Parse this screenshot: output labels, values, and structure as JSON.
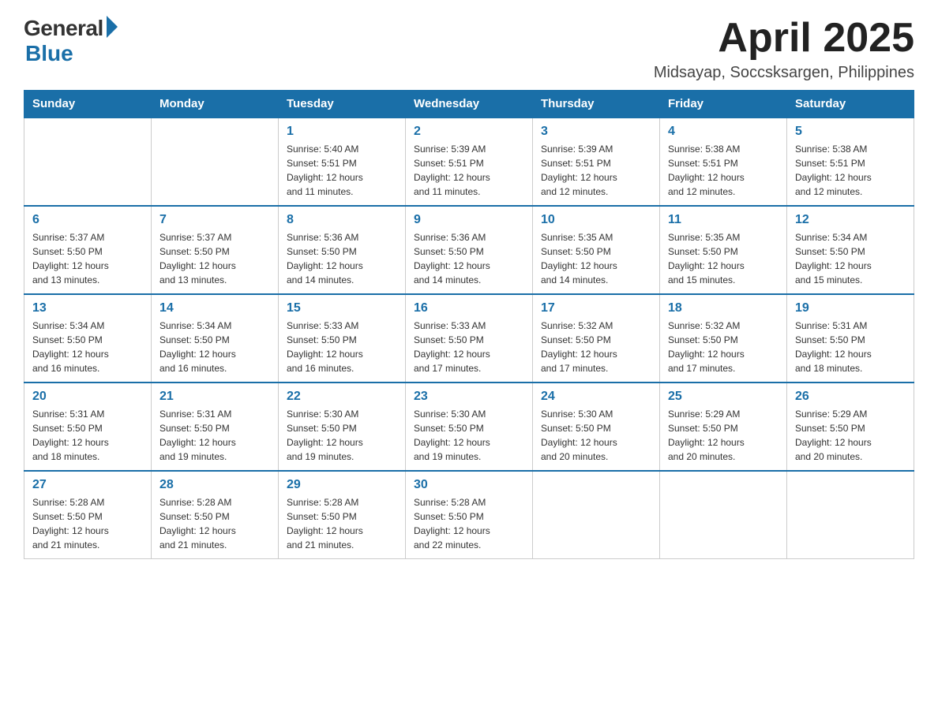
{
  "logo": {
    "general": "General",
    "blue": "Blue"
  },
  "title": {
    "month_year": "April 2025",
    "location": "Midsayap, Soccsksargen, Philippines"
  },
  "days_of_week": [
    "Sunday",
    "Monday",
    "Tuesday",
    "Wednesday",
    "Thursday",
    "Friday",
    "Saturday"
  ],
  "weeks": [
    [
      {
        "day": "",
        "info": ""
      },
      {
        "day": "",
        "info": ""
      },
      {
        "day": "1",
        "info": "Sunrise: 5:40 AM\nSunset: 5:51 PM\nDaylight: 12 hours\nand 11 minutes."
      },
      {
        "day": "2",
        "info": "Sunrise: 5:39 AM\nSunset: 5:51 PM\nDaylight: 12 hours\nand 11 minutes."
      },
      {
        "day": "3",
        "info": "Sunrise: 5:39 AM\nSunset: 5:51 PM\nDaylight: 12 hours\nand 12 minutes."
      },
      {
        "day": "4",
        "info": "Sunrise: 5:38 AM\nSunset: 5:51 PM\nDaylight: 12 hours\nand 12 minutes."
      },
      {
        "day": "5",
        "info": "Sunrise: 5:38 AM\nSunset: 5:51 PM\nDaylight: 12 hours\nand 12 minutes."
      }
    ],
    [
      {
        "day": "6",
        "info": "Sunrise: 5:37 AM\nSunset: 5:50 PM\nDaylight: 12 hours\nand 13 minutes."
      },
      {
        "day": "7",
        "info": "Sunrise: 5:37 AM\nSunset: 5:50 PM\nDaylight: 12 hours\nand 13 minutes."
      },
      {
        "day": "8",
        "info": "Sunrise: 5:36 AM\nSunset: 5:50 PM\nDaylight: 12 hours\nand 14 minutes."
      },
      {
        "day": "9",
        "info": "Sunrise: 5:36 AM\nSunset: 5:50 PM\nDaylight: 12 hours\nand 14 minutes."
      },
      {
        "day": "10",
        "info": "Sunrise: 5:35 AM\nSunset: 5:50 PM\nDaylight: 12 hours\nand 14 minutes."
      },
      {
        "day": "11",
        "info": "Sunrise: 5:35 AM\nSunset: 5:50 PM\nDaylight: 12 hours\nand 15 minutes."
      },
      {
        "day": "12",
        "info": "Sunrise: 5:34 AM\nSunset: 5:50 PM\nDaylight: 12 hours\nand 15 minutes."
      }
    ],
    [
      {
        "day": "13",
        "info": "Sunrise: 5:34 AM\nSunset: 5:50 PM\nDaylight: 12 hours\nand 16 minutes."
      },
      {
        "day": "14",
        "info": "Sunrise: 5:34 AM\nSunset: 5:50 PM\nDaylight: 12 hours\nand 16 minutes."
      },
      {
        "day": "15",
        "info": "Sunrise: 5:33 AM\nSunset: 5:50 PM\nDaylight: 12 hours\nand 16 minutes."
      },
      {
        "day": "16",
        "info": "Sunrise: 5:33 AM\nSunset: 5:50 PM\nDaylight: 12 hours\nand 17 minutes."
      },
      {
        "day": "17",
        "info": "Sunrise: 5:32 AM\nSunset: 5:50 PM\nDaylight: 12 hours\nand 17 minutes."
      },
      {
        "day": "18",
        "info": "Sunrise: 5:32 AM\nSunset: 5:50 PM\nDaylight: 12 hours\nand 17 minutes."
      },
      {
        "day": "19",
        "info": "Sunrise: 5:31 AM\nSunset: 5:50 PM\nDaylight: 12 hours\nand 18 minutes."
      }
    ],
    [
      {
        "day": "20",
        "info": "Sunrise: 5:31 AM\nSunset: 5:50 PM\nDaylight: 12 hours\nand 18 minutes."
      },
      {
        "day": "21",
        "info": "Sunrise: 5:31 AM\nSunset: 5:50 PM\nDaylight: 12 hours\nand 19 minutes."
      },
      {
        "day": "22",
        "info": "Sunrise: 5:30 AM\nSunset: 5:50 PM\nDaylight: 12 hours\nand 19 minutes."
      },
      {
        "day": "23",
        "info": "Sunrise: 5:30 AM\nSunset: 5:50 PM\nDaylight: 12 hours\nand 19 minutes."
      },
      {
        "day": "24",
        "info": "Sunrise: 5:30 AM\nSunset: 5:50 PM\nDaylight: 12 hours\nand 20 minutes."
      },
      {
        "day": "25",
        "info": "Sunrise: 5:29 AM\nSunset: 5:50 PM\nDaylight: 12 hours\nand 20 minutes."
      },
      {
        "day": "26",
        "info": "Sunrise: 5:29 AM\nSunset: 5:50 PM\nDaylight: 12 hours\nand 20 minutes."
      }
    ],
    [
      {
        "day": "27",
        "info": "Sunrise: 5:28 AM\nSunset: 5:50 PM\nDaylight: 12 hours\nand 21 minutes."
      },
      {
        "day": "28",
        "info": "Sunrise: 5:28 AM\nSunset: 5:50 PM\nDaylight: 12 hours\nand 21 minutes."
      },
      {
        "day": "29",
        "info": "Sunrise: 5:28 AM\nSunset: 5:50 PM\nDaylight: 12 hours\nand 21 minutes."
      },
      {
        "day": "30",
        "info": "Sunrise: 5:28 AM\nSunset: 5:50 PM\nDaylight: 12 hours\nand 22 minutes."
      },
      {
        "day": "",
        "info": ""
      },
      {
        "day": "",
        "info": ""
      },
      {
        "day": "",
        "info": ""
      }
    ]
  ]
}
